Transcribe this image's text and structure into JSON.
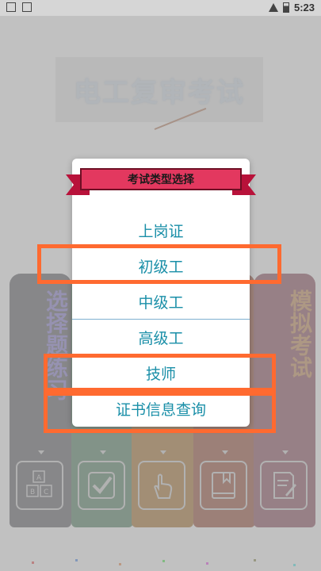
{
  "status_bar": {
    "time": "5:23"
  },
  "app": {
    "title": "电工复审考试",
    "books": [
      {
        "label": "选择题练习",
        "icon": "abc-blocks-icon"
      },
      {
        "label": "",
        "icon": "checkmark-icon"
      },
      {
        "label": "",
        "icon": "tap-hand-icon"
      },
      {
        "label": "",
        "icon": "bookmark-book-icon"
      },
      {
        "label": "模拟考试",
        "icon": "exam-paper-icon"
      }
    ]
  },
  "dialog": {
    "title": "考试类型选择",
    "items": [
      {
        "label": "上岗证"
      },
      {
        "label": "初级工"
      },
      {
        "label": "中级工"
      },
      {
        "label": "高级工"
      },
      {
        "label": "技师"
      },
      {
        "label": "证书信息查询"
      }
    ]
  },
  "colors": {
    "accent": "#1a8fa8",
    "ribbon": "#e3385f",
    "highlight": "#ff6a30"
  }
}
